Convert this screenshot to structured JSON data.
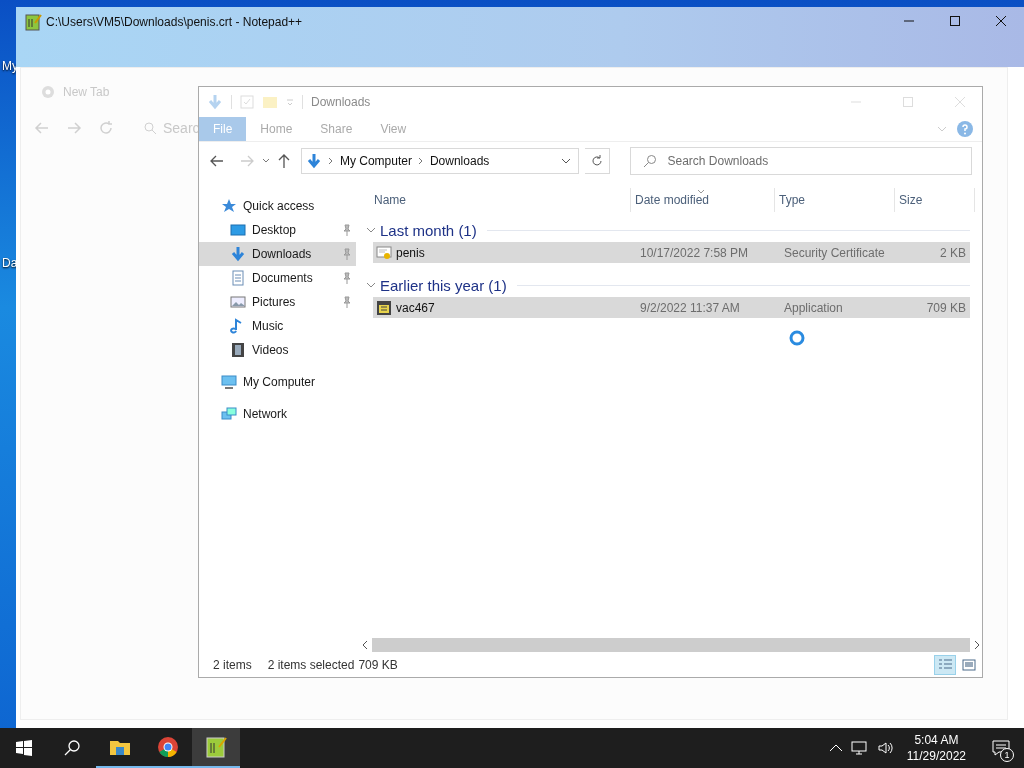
{
  "desktop_icons": [
    {
      "label": "My"
    },
    {
      "label": "Da"
    }
  ],
  "notepad_window": {
    "title": "C:\\Users\\VM5\\Downloads\\penis.crt - Notepad++"
  },
  "browser_window": {
    "tab": "New Tab",
    "search_placeholder": "Searc"
  },
  "explorer": {
    "title": "Downloads",
    "ribbon_tabs": [
      {
        "label": "File",
        "selected": true
      },
      {
        "label": "Home",
        "selected": false
      },
      {
        "label": "Share",
        "selected": false
      },
      {
        "label": "View",
        "selected": false
      }
    ],
    "breadcrumb": [
      "My Computer",
      "Downloads"
    ],
    "search": {
      "placeholder": "Search Downloads"
    },
    "sidebar": {
      "items": [
        {
          "label": "Quick access",
          "selected": false,
          "children": [
            {
              "label": "Desktop",
              "selected": false,
              "pinned": true
            },
            {
              "label": "Downloads",
              "selected": true,
              "pinned": true
            },
            {
              "label": "Documents",
              "selected": false,
              "pinned": true
            },
            {
              "label": "Pictures",
              "selected": false,
              "pinned": true
            },
            {
              "label": "Music",
              "selected": false,
              "pinned": false
            },
            {
              "label": "Videos",
              "selected": false,
              "pinned": false
            }
          ]
        },
        {
          "label": "My Computer",
          "selected": false
        },
        {
          "label": "Network",
          "selected": false
        }
      ]
    },
    "columns": [
      {
        "label": "Name",
        "sorted": false
      },
      {
        "label": "Date modified",
        "sorted": true
      },
      {
        "label": "Type",
        "sorted": false
      },
      {
        "label": "Size",
        "sorted": false
      }
    ],
    "groups": [
      {
        "label": "Last month (1)",
        "expanded": true,
        "rows": [
          {
            "name": "penis",
            "date": "10/17/2022 7:58 PM",
            "type": "Security Certificate",
            "size": "2 KB",
            "selected": true
          }
        ]
      },
      {
        "label": "Earlier this year (1)",
        "expanded": true,
        "rows": [
          {
            "name": "vac467",
            "date": "9/2/2022 11:37 AM",
            "type": "Application",
            "size": "709 KB",
            "selected": true
          }
        ]
      }
    ],
    "status_bar": {
      "item_count": "2 items",
      "selection": "2 items selected",
      "size": "709 KB"
    },
    "view_buttons": [
      {
        "selected": true
      },
      {
        "selected": false
      }
    ]
  },
  "taskbar": {
    "apps": [
      {
        "running": true,
        "selected": false
      },
      {
        "running": true,
        "selected": false
      },
      {
        "running": true,
        "selected": true
      }
    ],
    "time": "5:04 AM",
    "date": "11/29/2022",
    "notification_count": "1"
  }
}
